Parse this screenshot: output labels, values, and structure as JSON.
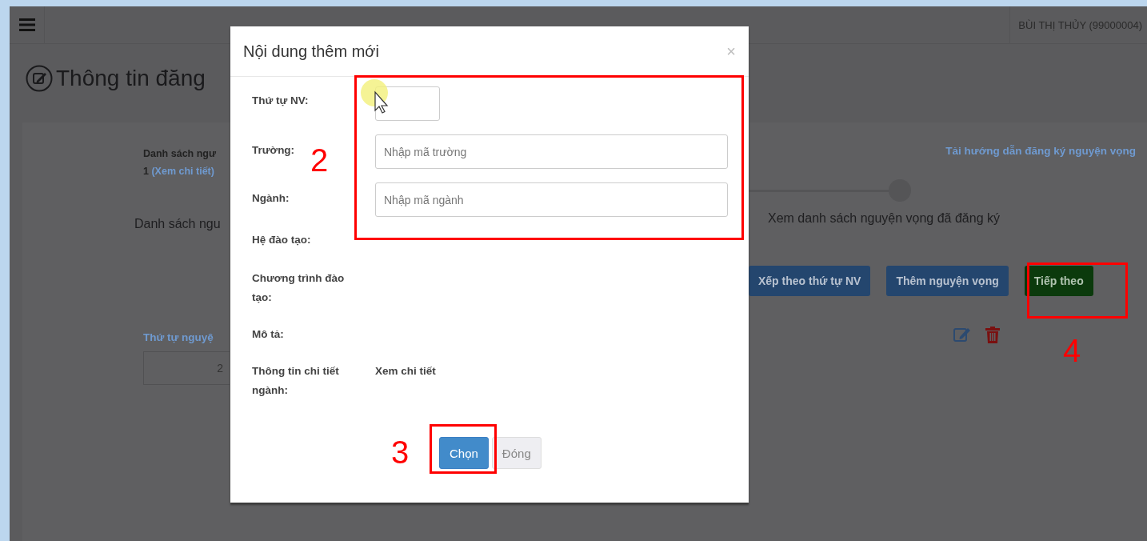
{
  "topbar": {
    "user": "BÙI THỊ THỦY (99000004)"
  },
  "page": {
    "title": "Thông tin đăng",
    "list_label": "Danh sách ngư",
    "list_count": "1",
    "list_link": "(Xem chi tiết)",
    "guide_link": "Tải hướng dẫn đăng ký nguyện vọng",
    "steps": [
      {
        "label": "Danh sách ngu"
      },
      {
        "label": "Xem danh sách nguyện vọng đã đăng ký"
      }
    ],
    "actions": [
      {
        "label": "Xếp theo thứ tự NV",
        "kind": "primary"
      },
      {
        "label": "Thêm nguyện vọng",
        "kind": "primary"
      },
      {
        "label": "Tiếp theo",
        "kind": "success"
      }
    ],
    "order_label": "Thứ tự nguyệ",
    "order_value": "2"
  },
  "modal": {
    "title": "Nội dung thêm mới",
    "close": "×",
    "fields": [
      {
        "label": "Thứ tự NV:",
        "kind": "number"
      },
      {
        "label": "Trường:",
        "kind": "text",
        "placeholder": "Nhập mã trường"
      },
      {
        "label": "Ngành:",
        "kind": "text",
        "placeholder": "Nhập mã ngành"
      },
      {
        "label": "Hệ đào tạo:",
        "kind": "static"
      },
      {
        "label": "Chương trình đào tạo:",
        "kind": "static"
      },
      {
        "label": "Mô tả:",
        "kind": "static"
      },
      {
        "label": "Thông tin chi tiết ngành:",
        "kind": "static",
        "value": "Xem chi tiết"
      }
    ],
    "buttons": [
      {
        "label": "Chọn",
        "kind": "primary"
      },
      {
        "label": "Đóng",
        "kind": "default"
      }
    ]
  },
  "annotations": [
    {
      "label": "2"
    },
    {
      "label": "3"
    },
    {
      "label": "4"
    }
  ]
}
